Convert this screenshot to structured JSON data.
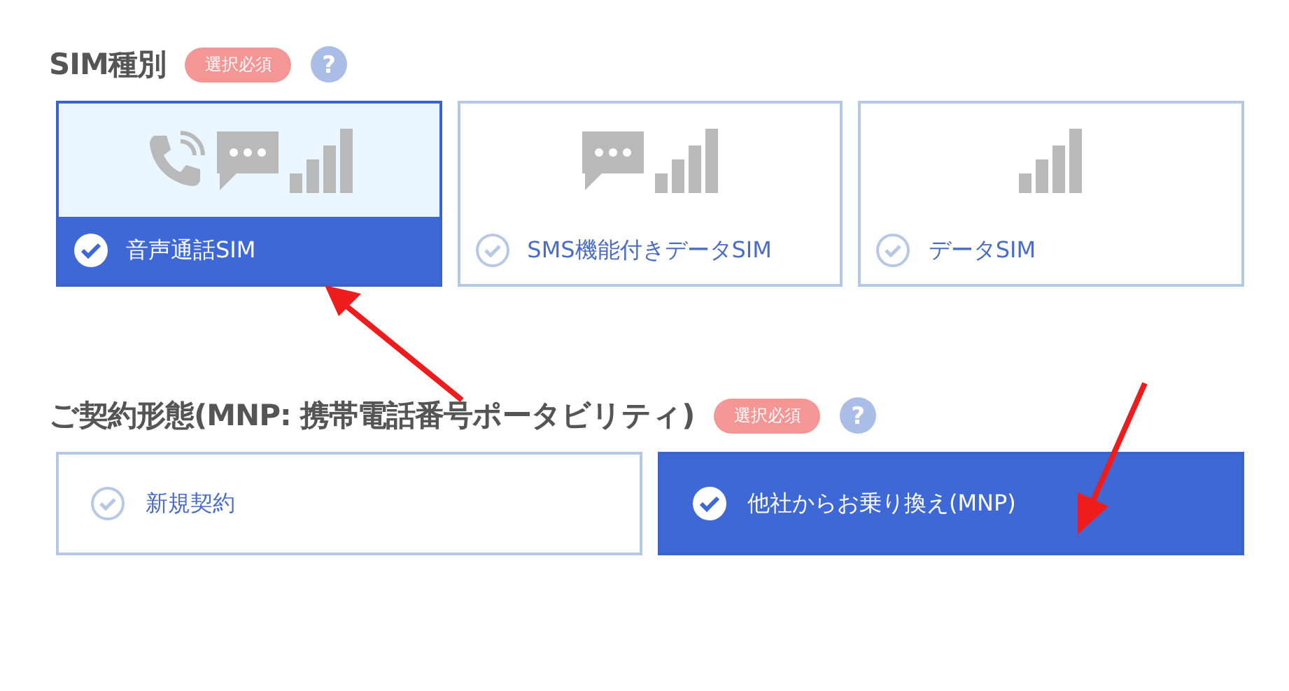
{
  "sections": [
    {
      "title": "SIM種別",
      "badge": "選択必須",
      "help": "?",
      "kind": "tall",
      "options": [
        {
          "label": "音声通話SIM",
          "selected": true,
          "icons": [
            {
              "kind": "phone"
            },
            {
              "kind": "chat"
            },
            {
              "kind": "signal"
            }
          ]
        },
        {
          "label": "SMS機能付きデータSIM",
          "selected": false,
          "icons": [
            {
              "kind": "chat"
            },
            {
              "kind": "signal"
            }
          ]
        },
        {
          "label": "データSIM",
          "selected": false,
          "icons": [
            {
              "kind": "signal"
            }
          ]
        }
      ]
    },
    {
      "title": "ご契約形態(MNP: 携帯電話番号ポータビリティ)",
      "badge": "選択必須",
      "help": "?",
      "kind": "flat",
      "options": [
        {
          "label": "新規契約",
          "selected": false
        },
        {
          "label": "他社からお乗り換え(MNP)",
          "selected": true
        }
      ]
    }
  ]
}
